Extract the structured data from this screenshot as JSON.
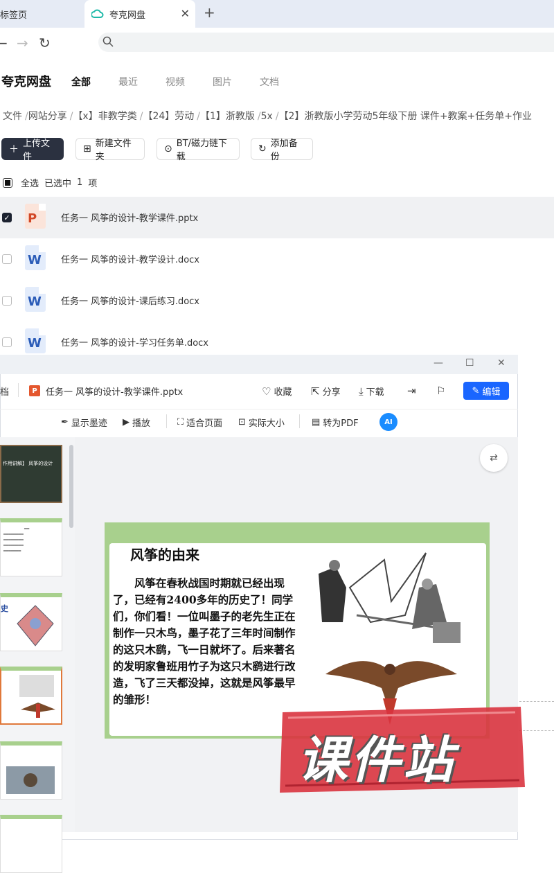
{
  "browser": {
    "tabs": [
      {
        "title": "标签页"
      },
      {
        "title": "夸克网盘"
      }
    ],
    "new_tab": "+",
    "close": "✕"
  },
  "app": {
    "title": "夸克网盘",
    "nav_tabs": [
      "全部",
      "最近",
      "视频",
      "图片",
      "文档"
    ],
    "active_tab": "全部"
  },
  "breadcrumb": [
    "文件",
    "网站分享",
    "【x】非教学类",
    "【24】劳动",
    "【1】浙教版",
    "5x",
    "【2】浙教版小学劳动5年级下册 课件+教案+任务单+作业"
  ],
  "toolbar": {
    "upload": "上传文件",
    "new_folder": "新建文件夹",
    "bt": "BT/磁力链下载",
    "backup": "添加备份"
  },
  "selection": {
    "select_all": "全选",
    "selected_text": "已选中",
    "count": "1",
    "unit": "项"
  },
  "files": [
    {
      "name": "任务一 风筝的设计-教学课件.pptx",
      "type": "ppt",
      "letter": "P",
      "selected": true
    },
    {
      "name": "任务一 风筝的设计-教学设计.docx",
      "type": "doc",
      "letter": "W",
      "selected": false
    },
    {
      "name": "任务一 风筝的设计-课后练习.docx",
      "type": "doc",
      "letter": "W",
      "selected": false
    },
    {
      "name": "任务一 风筝的设计-学习任务单.docx",
      "type": "doc",
      "letter": "W",
      "selected": false
    }
  ],
  "preview": {
    "doc_label": "档",
    "file_icon": "P",
    "filename": "任务一 风筝的设计-教学课件.pptx",
    "actions": {
      "collect": "收藏",
      "share": "分享",
      "download": "下载",
      "edit": "编辑"
    },
    "toolbar": {
      "ink": "显示墨迹",
      "play": "播放",
      "fit": "适合页面",
      "actual": "实际大小",
      "to_pdf": "转为PDF",
      "ai": "AI"
    },
    "thumb1_title": "作用讲解】 风筝的设计",
    "thumb3_title": "史"
  },
  "slide": {
    "title": "风筝的由来",
    "body": "风筝在春秋战国时期就已经出现了，已经有2400多年的历史了！同学们，你们看！一位叫墨子的老先生正在制作一只木鸟，墨子花了三年时间制作的这只木鹞，飞一日就坏了。后来著名的发明家鲁班用竹子为这只木鹞进行改造，飞了三天都没掉，这就是风筝最早的雏形！"
  },
  "watermark": "课件站"
}
